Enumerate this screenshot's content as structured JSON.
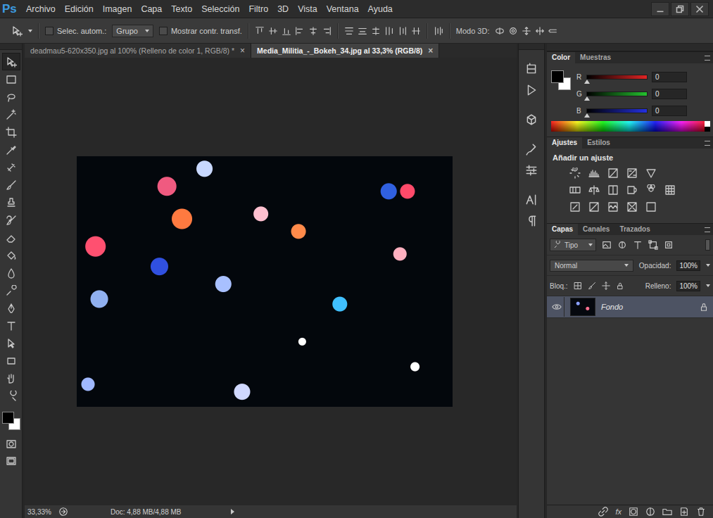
{
  "app": {
    "logo": "Ps"
  },
  "menu": [
    "Archivo",
    "Edición",
    "Imagen",
    "Capa",
    "Texto",
    "Selección",
    "Filtro",
    "3D",
    "Vista",
    "Ventana",
    "Ayuda"
  ],
  "options_bar": {
    "auto_select": {
      "label": "Selec. autom.:",
      "checked": false
    },
    "auto_select_target": "Grupo",
    "show_transform": {
      "label": "Mostrar contr. transf.",
      "checked": false
    },
    "mode_3d_label": "Modo 3D:"
  },
  "document_tabs": [
    {
      "label": "deadmau5-620x350.jpg al 100% (Relleno de color 1, RGB/8) *",
      "close": "×",
      "selected": false
    },
    {
      "label": "Media_Militia_-_Bokeh_34.jpg al 33,3% (RGB/8)",
      "close": "×",
      "selected": true
    }
  ],
  "tools": [
    {
      "kind": "move",
      "selected": true
    },
    {
      "kind": "marquee",
      "selected": false
    },
    {
      "kind": "lasso",
      "selected": false
    },
    {
      "kind": "magic-wand",
      "selected": false
    },
    {
      "kind": "crop",
      "selected": false
    },
    {
      "kind": "eyedropper",
      "selected": false
    },
    {
      "kind": "healing",
      "selected": false
    },
    {
      "kind": "brush",
      "selected": false
    },
    {
      "kind": "stamp",
      "selected": false
    },
    {
      "kind": "history-brush",
      "selected": false
    },
    {
      "kind": "eraser",
      "selected": false
    },
    {
      "kind": "bucket",
      "selected": false
    },
    {
      "kind": "blur",
      "selected": false
    },
    {
      "kind": "dodge",
      "selected": false
    },
    {
      "kind": "pen",
      "selected": false
    },
    {
      "kind": "type",
      "selected": false
    },
    {
      "kind": "path-select",
      "selected": false
    },
    {
      "kind": "shape",
      "selected": false
    },
    {
      "kind": "hand",
      "selected": false
    },
    {
      "kind": "zoom",
      "selected": false
    }
  ],
  "status_bar": {
    "zoom": "33,33%",
    "doc": "Doc: 4,88 MB/4,88 MB"
  },
  "color_panel": {
    "tabs": [
      {
        "label": "Color",
        "selected": true
      },
      {
        "label": "Muestras",
        "selected": false
      }
    ],
    "foreground": "#000000",
    "background": "#ffffff",
    "channels": [
      {
        "name": "R",
        "value": "0",
        "level": 0,
        "color": "#e02424"
      },
      {
        "name": "G",
        "value": "0",
        "level": 0,
        "color": "#24c02e"
      },
      {
        "name": "B",
        "value": "0",
        "level": 0,
        "color": "#2430e0"
      }
    ]
  },
  "adjustments_panel": {
    "tabs": [
      {
        "label": "Ajustes",
        "selected": true
      },
      {
        "label": "Estilos",
        "selected": false
      }
    ],
    "heading": "Añadir un ajuste"
  },
  "layers_panel": {
    "tabs": [
      {
        "label": "Capas",
        "selected": true
      },
      {
        "label": "Canales",
        "selected": false
      },
      {
        "label": "Trazados",
        "selected": false
      }
    ],
    "filter": "Tipo",
    "blend_mode": "Normal",
    "opacity_label": "Opacidad:",
    "opacity": "100%",
    "lock_label": "Bloq.:",
    "fill_label": "Relleno:",
    "fill": "100%",
    "fx_label": "fx",
    "layers": [
      {
        "name": "Fondo",
        "visible": true,
        "locked": true,
        "selected": true
      }
    ]
  }
}
